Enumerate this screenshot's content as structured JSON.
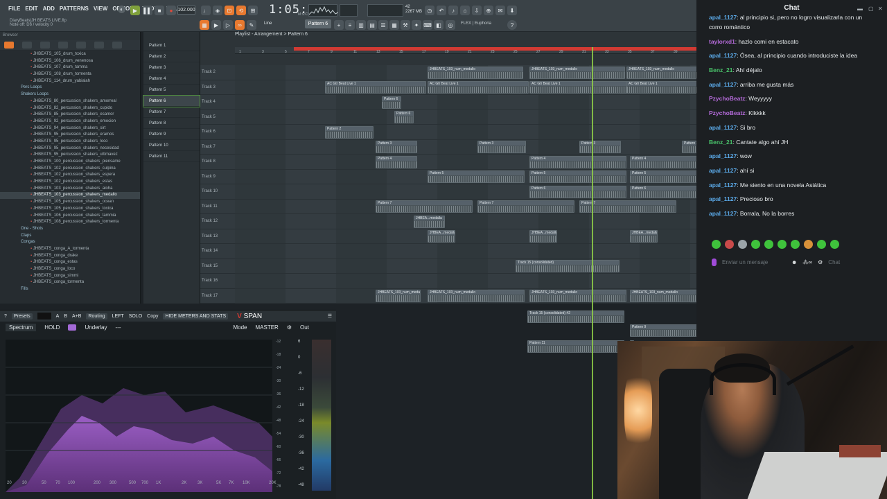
{
  "menu": [
    "FILE",
    "EDIT",
    "ADD",
    "PATTERNS",
    "VIEW",
    "OPTIONS",
    "TOOLS",
    "HELP"
  ],
  "song_info": [
    "DiaryBeats|JH BEATS LIVE.flp",
    "Note off: D6 / velocity 0"
  ],
  "tempo": "102.000",
  "time": "1:05:42",
  "time_sub": "M:S:CS",
  "cpu_text": [
    "42",
    "2267 MB"
  ],
  "pattern_selector": "Pattern 6",
  "line_mode": "Line",
  "flex_preset": "FLEX | Euphoria",
  "playlist_title": "Playlist - Arrangement > Pattern 6",
  "browser": {
    "header": "Browser",
    "items": [
      {
        "t": "JHBEATS_105_drum_toxica",
        "k": "file"
      },
      {
        "t": "JHBEATS_106_drum_venenosa",
        "k": "file"
      },
      {
        "t": "JHBEATS_107_drum_tamma",
        "k": "file"
      },
      {
        "t": "JHBEATS_108_drum_tormenta",
        "k": "file"
      },
      {
        "t": "JHBEATS_114_drum_yabialah",
        "k": "file"
      },
      {
        "t": "Perc Loops",
        "k": "folder"
      },
      {
        "t": "Shakers Loops",
        "k": "folder"
      },
      {
        "t": "JHBEATS_80_percussion_shakers_amorreal",
        "k": "file"
      },
      {
        "t": "JHBEATS_82_percussion_shakers_cupido",
        "k": "file"
      },
      {
        "t": "JHBEATS_85_percussion_shakers_esamor",
        "k": "file"
      },
      {
        "t": "JHBEATS_92_percussion_shakers_emocion",
        "k": "file"
      },
      {
        "t": "JHBEATS_94_percussion_shakers_sirt",
        "k": "file"
      },
      {
        "t": "JHBEATS_95_percussion_shakers_eramos",
        "k": "file"
      },
      {
        "t": "JHBEATS_95_percussion_shakers_loco",
        "k": "file"
      },
      {
        "t": "JHBEATS_95_percussion_shakers_necesidad",
        "k": "file"
      },
      {
        "t": "JHBEATS_95_percussion_shakers_ultimavez",
        "k": "file"
      },
      {
        "t": "JHBEATS_100_percussion_shakers_piensame",
        "k": "file"
      },
      {
        "t": "JHBEATS_102_percussion_shakers_culpina",
        "k": "file"
      },
      {
        "t": "JHBEATS_102_percussion_shakers_espera",
        "k": "file"
      },
      {
        "t": "JHBEATS_102_percussion_shakers_estas",
        "k": "file"
      },
      {
        "t": "JHBEATS_103_percussion_shakers_aloha",
        "k": "file"
      },
      {
        "t": "JHBEATS_103_percussion_shakers_medallo",
        "k": "file",
        "sel": true
      },
      {
        "t": "JHBEATS_105_percussion_shakers_ocean",
        "k": "file"
      },
      {
        "t": "JHBEATS_105_percussion_shakers_toxica",
        "k": "file"
      },
      {
        "t": "JHBEATS_106_percussion_shakers_tammia",
        "k": "file"
      },
      {
        "t": "JHBEATS_108_percussion_shakers_tormenta",
        "k": "file"
      },
      {
        "t": "One - Shots",
        "k": "folder"
      },
      {
        "t": "Claps",
        "k": "folder"
      },
      {
        "t": "Congas",
        "k": "folder"
      },
      {
        "t": "JHBEATS_conga_A_tormenta",
        "k": "file"
      },
      {
        "t": "JHBEATS_conga_drake",
        "k": "file"
      },
      {
        "t": "JHBEATS_conga_estas",
        "k": "file"
      },
      {
        "t": "JHBEATS_conga_loco",
        "k": "file"
      },
      {
        "t": "JHBEATS_conga_simmi",
        "k": "file"
      },
      {
        "t": "JHBEATS_conga_tormenta",
        "k": "file"
      },
      {
        "t": "Fills",
        "k": "folder"
      }
    ]
  },
  "patterns": [
    "Pattern 1",
    "Pattern 2",
    "Pattern 3",
    "Pattern 4",
    "Pattern 5",
    "Pattern 6",
    "Pattern 7",
    "Pattern 8",
    "Pattern 9",
    "Pattern 10",
    "Pattern 11"
  ],
  "selected_pattern": "Pattern 6",
  "tracks": [
    "Track 2",
    "Track 3",
    "Track 4",
    "Track 5",
    "Track 6",
    "Track 7",
    "Track 8",
    "Track 9",
    "Track 10",
    "Track 11",
    "Track 12",
    "Track 13",
    "Track 14",
    "Track 15",
    "Track 16",
    "Track 17"
  ],
  "ruler_ticks": [
    "1",
    "3",
    "5",
    "7",
    "9",
    "11",
    "13",
    "15",
    "17",
    "19",
    "21",
    "23",
    "25",
    "27",
    "29",
    "31",
    "33",
    "35",
    "37",
    "39"
  ],
  "clip_labels": {
    "ac_gtr": "AC Gtr Beat Live 1",
    "medallo": "JHBEATS_103_num_medallo",
    "pattern3": "Pattern 3",
    "pattern4": "Pattern 4",
    "pattern5": "Pattern 5",
    "pattern6": "Pattern 6",
    "pattern7": "Pattern 7",
    "pattern9": "Pattern 9",
    "pattern2": "Pattern 2",
    "medalla": "JHBEA...medalla",
    "consolidated15": "Track 15 (consolidated)",
    "consolidated15b": "Track 15 (consolidated) #2",
    "pattern11": "Pattern 11"
  },
  "analyzer": {
    "presets": "Presets",
    "buttons": [
      "A",
      "B",
      "A+B"
    ],
    "routing": "Routing",
    "left": "LEFT",
    "solo": "SOLO",
    "copy": "Copy",
    "hide_meters": "HIDE METERS AND STATS",
    "brand": "SPAN",
    "spectrum_tab": "Spectrum",
    "hold": "HOLD",
    "underlay": "Underlay",
    "mode": "Mode",
    "master": "MASTER",
    "out": "Out",
    "db_ticks": [
      "-12",
      "-18",
      "-24",
      "-30",
      "-36",
      "-42",
      "-48",
      "-54",
      "-60",
      "-66",
      "-72",
      "-78"
    ],
    "meter_ticks": [
      "6",
      "0",
      "-6",
      "-12",
      "-18",
      "-24",
      "-30",
      "-36",
      "-42",
      "-48"
    ],
    "freq_ticks": [
      "20",
      "30",
      "50",
      "70",
      "100",
      "200",
      "300",
      "500",
      "700",
      "1K",
      "2K",
      "3K",
      "5K",
      "7K",
      "10K",
      "20K"
    ]
  },
  "chat": {
    "title": "Chat",
    "messages": [
      {
        "user": "apal_1127",
        "color": "#5aa8e6",
        "text": ": al principio si, pero no logro visualizarla con un corro romántico"
      },
      {
        "user": "taylorxd1",
        "color": "#b36ad8",
        "text": ": hazlo comi en estacato"
      },
      {
        "user": "apal_1127",
        "color": "#5aa8e6",
        "text": ": Ósea, al principio cuando introduciste la idea"
      },
      {
        "user": "Benz_21",
        "color": "#49c26a",
        "text": ": Ahí déjalo"
      },
      {
        "user": "apal_1127",
        "color": "#5aa8e6",
        "text": ": arriba me gusta más"
      },
      {
        "user": "PzychoBeatz",
        "color": "#b36ad8",
        "text": ": Weyyyyy"
      },
      {
        "user": "PzychoBeatz",
        "color": "#b36ad8",
        "text": ": Klkkkk"
      },
      {
        "user": "apal_1127",
        "color": "#5aa8e6",
        "text": ": Si bro"
      },
      {
        "user": "Benz_21",
        "color": "#49c26a",
        "text": ": Cantate algo ahí JH"
      },
      {
        "user": "apal_1127",
        "color": "#5aa8e6",
        "text": ": wow"
      },
      {
        "user": "apal_1127",
        "color": "#5aa8e6",
        "text": ": ahí si"
      },
      {
        "user": "apal_1127",
        "color": "#5aa8e6",
        "text": ": Me siento en una novela Asiática"
      },
      {
        "user": "apal_1127",
        "color": "#5aa8e6",
        "text": ": Precioso bro"
      },
      {
        "user": "apal_1127",
        "color": "#5aa8e6",
        "text": ": Borrala, No la borres"
      }
    ],
    "input_placeholder": "Enviar un mensaje",
    "send_label": "Chat"
  }
}
